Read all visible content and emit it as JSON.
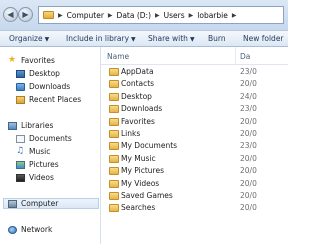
{
  "address_bar": {
    "crumbs": [
      "Computer",
      "Data (D:)",
      "Users",
      "lobarbie"
    ]
  },
  "toolbar": {
    "organize": "Organize",
    "include": "Include in library",
    "share": "Share with",
    "burn": "Burn",
    "new_folder": "New folder"
  },
  "nav": {
    "favorites": "Favorites",
    "desktop": "Desktop",
    "downloads": "Downloads",
    "recent": "Recent Places",
    "libraries": "Libraries",
    "documents": "Documents",
    "music": "Music",
    "pictures": "Pictures",
    "videos": "Videos",
    "computer": "Computer",
    "network": "Network"
  },
  "content": {
    "col_name": "Name",
    "col_date": "Da",
    "rows": [
      {
        "name": "AppData",
        "date": "23/0"
      },
      {
        "name": "Contacts",
        "date": "20/0"
      },
      {
        "name": "Desktop",
        "date": "24/0"
      },
      {
        "name": "Downloads",
        "date": "23/0"
      },
      {
        "name": "Favorites",
        "date": "20/0"
      },
      {
        "name": "Links",
        "date": "20/0"
      },
      {
        "name": "My Documents",
        "date": "23/0"
      },
      {
        "name": "My Music",
        "date": "20/0"
      },
      {
        "name": "My Pictures",
        "date": "20/0"
      },
      {
        "name": "My Videos",
        "date": "20/0"
      },
      {
        "name": "Saved Games",
        "date": "20/0"
      },
      {
        "name": "Searches",
        "date": "20/0"
      }
    ]
  },
  "colors": {
    "toolbar_text": "#1e395b",
    "header_text": "#4c607a",
    "folder": "#e5b446"
  }
}
